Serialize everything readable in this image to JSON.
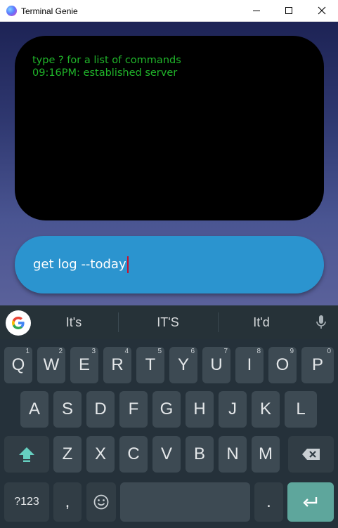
{
  "window": {
    "title": "Terminal Genie"
  },
  "terminal": {
    "lines": [
      "type ? for a list of commands",
      "09:16PM: established server"
    ]
  },
  "command_input": {
    "value": "get log --today"
  },
  "keyboard": {
    "suggestions": [
      "It's",
      "IT'S",
      "It'd"
    ],
    "row1": [
      {
        "label": "Q",
        "hint": "1"
      },
      {
        "label": "W",
        "hint": "2"
      },
      {
        "label": "E",
        "hint": "3"
      },
      {
        "label": "R",
        "hint": "4"
      },
      {
        "label": "T",
        "hint": "5"
      },
      {
        "label": "Y",
        "hint": "6"
      },
      {
        "label": "U",
        "hint": "7"
      },
      {
        "label": "I",
        "hint": "8"
      },
      {
        "label": "O",
        "hint": "9"
      },
      {
        "label": "P",
        "hint": "0"
      }
    ],
    "row2": [
      "A",
      "S",
      "D",
      "F",
      "G",
      "H",
      "J",
      "K",
      "L"
    ],
    "row3": [
      "Z",
      "X",
      "C",
      "V",
      "B",
      "N",
      "M"
    ],
    "symbols_label": "?123",
    "comma_label": ",",
    "period_label": "."
  },
  "colors": {
    "terminal_text": "#20b52a",
    "input_bg": "#2b94cf",
    "enter_key": "#5ea69c",
    "keyboard_bg": "#25313a"
  }
}
